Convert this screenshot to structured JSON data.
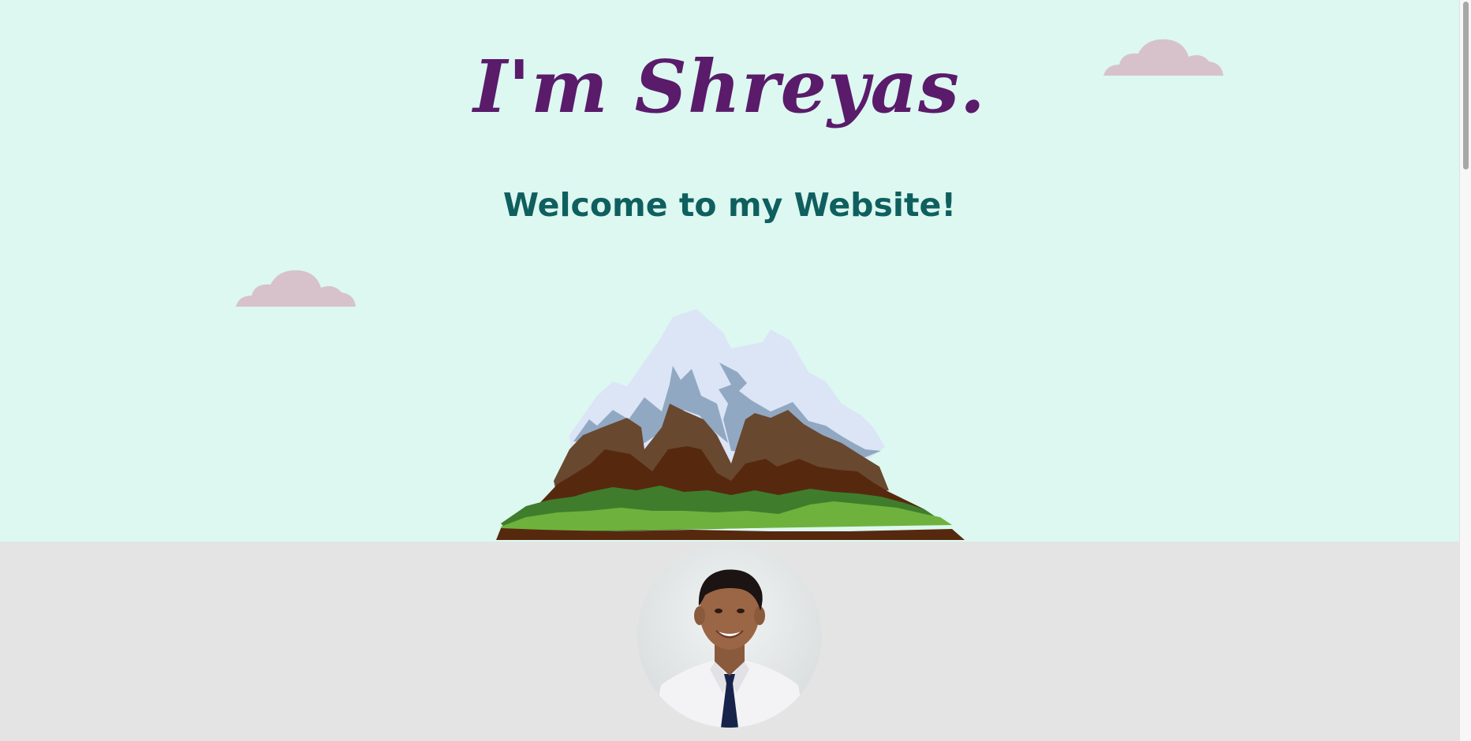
{
  "hero": {
    "title": "I'm Shreyas.",
    "subtitle": "Welcome to my Website!",
    "background_color": "#dcf8f0",
    "title_color": "#5a1b6b",
    "subtitle_color": "#0f5f5f"
  },
  "clouds": [
    {
      "name": "cloud-right-icon",
      "color": "#d7c2cc"
    },
    {
      "name": "cloud-left-icon",
      "color": "#d7c2cc"
    }
  ],
  "mountain": {
    "icon": "mountain-illustration",
    "colors": {
      "snow": "#dbe5f6",
      "shadow": "#91a8c2",
      "rock_light": "#694830",
      "rock_dark": "#56290f",
      "grass_dark": "#3f7d2c",
      "grass_light": "#6eb23d"
    }
  },
  "about": {
    "background_color": "#e4e4e4",
    "avatar": "profile-photo"
  }
}
